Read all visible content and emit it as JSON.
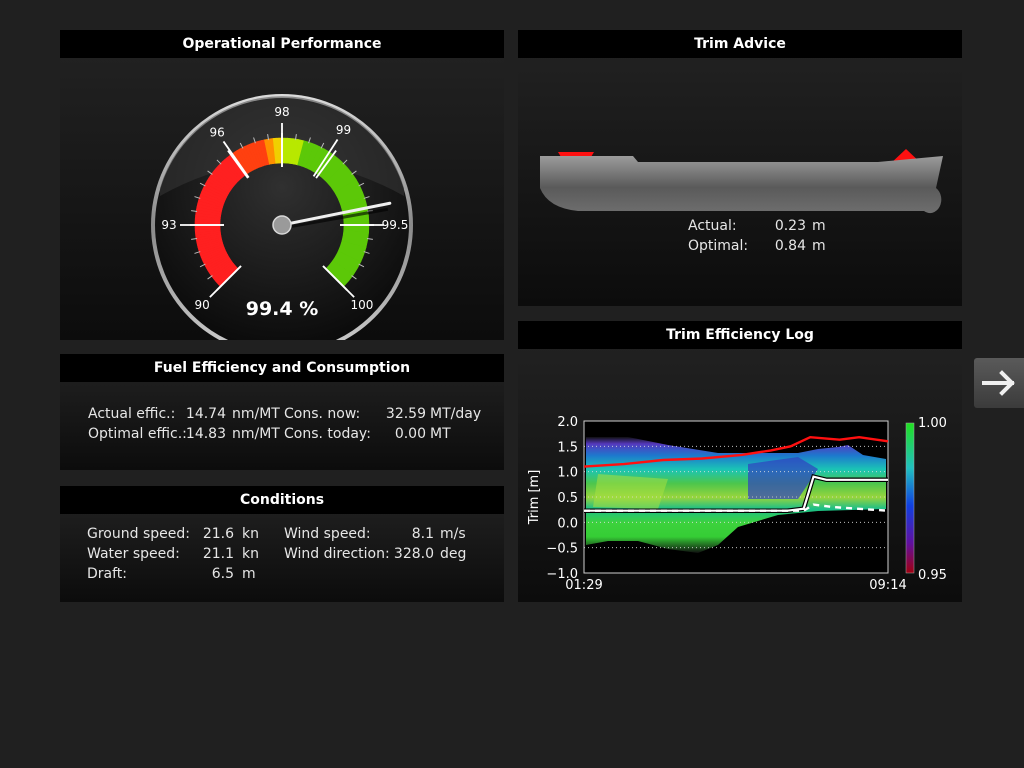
{
  "operational": {
    "title": "Operational Performance",
    "value": 99.4,
    "readout": "99.4 %",
    "ticks": [
      "90",
      "93",
      "96",
      "98",
      "99",
      "99.5",
      "100"
    ]
  },
  "trim_advice": {
    "title": "Trim Advice",
    "actual_label": "Actual:",
    "actual_value": "0.23",
    "optimal_label": "Optimal:",
    "optimal_value": "0.84",
    "unit": "m"
  },
  "fuel": {
    "title": "Fuel Efficiency and Consumption",
    "actual_label": "Actual effic.:",
    "actual_value": "14.74",
    "actual_unit": "nm/MT",
    "optimal_label": "Optimal effic.:",
    "optimal_value": "14.83",
    "optimal_unit": "nm/MT",
    "cons_now_label": "Cons. now:",
    "cons_now_value": "32.59",
    "cons_now_unit": "MT/day",
    "cons_today_label": "Cons. today:",
    "cons_today_value": "0.00",
    "cons_today_unit": "MT"
  },
  "conditions": {
    "title": "Conditions",
    "ground_label": "Ground speed:",
    "ground_value": "21.6",
    "ground_unit": "kn",
    "water_label": "Water speed:",
    "water_value": "21.1",
    "water_unit": "kn",
    "draft_label": "Draft:",
    "draft_value": "6.5",
    "draft_unit": "m",
    "wind_speed_label": "Wind speed:",
    "wind_speed_value": "8.1",
    "wind_speed_unit": "m/s",
    "wind_dir_label": "Wind direction:",
    "wind_dir_value": "328.0",
    "wind_dir_unit": "deg"
  },
  "trim_log": {
    "title": "Trim Efficiency Log",
    "ylabel": "Trim [m]",
    "yticks": [
      "2.0",
      "1.5",
      "1.0",
      "0.5",
      "0.0",
      "−0.5",
      "−1.0"
    ],
    "xticks": [
      "01:29",
      "09:14"
    ],
    "colorbar_max": "1.00",
    "colorbar_min": "0.95"
  },
  "chart_data": {
    "type": "heatmap",
    "title": "Trim Efficiency Log",
    "xlabel": "",
    "ylabel": "Trim [m]",
    "ylim": [
      -1.0,
      2.0
    ],
    "x_range": [
      "01:29",
      "09:14"
    ],
    "colorbar_range": [
      0.95,
      1.0
    ],
    "series": [
      {
        "values": [
          {
            "x": "01:29",
            "y": 1.1
          },
          {
            "x": "02:30",
            "y": 1.15
          },
          {
            "x": "03:30",
            "y": 1.23
          },
          {
            "x": "04:30",
            "y": 1.26
          },
          {
            "x": "05:30",
            "y": 1.33
          },
          {
            "x": "06:15",
            "y": 1.42
          },
          {
            "x": "06:45",
            "y": 1.5
          },
          {
            "x": "07:15",
            "y": 1.68
          },
          {
            "x": "08:00",
            "y": 1.63
          },
          {
            "x": "08:30",
            "y": 1.68
          },
          {
            "x": "09:14",
            "y": 1.6
          }
        ]
      },
      {
        "values": [
          {
            "x": "01:29",
            "y": 0.23
          },
          {
            "x": "06:40",
            "y": 0.23
          },
          {
            "x": "07:05",
            "y": 0.27
          },
          {
            "x": "07:20",
            "y": 0.9
          },
          {
            "x": "07:40",
            "y": 0.84
          },
          {
            "x": "09:14",
            "y": 0.84
          }
        ]
      },
      {
        "values": [
          {
            "x": "01:29",
            "y": 0.23
          },
          {
            "x": "07:05",
            "y": 0.23
          },
          {
            "x": "07:20",
            "y": 0.35
          },
          {
            "x": "07:50",
            "y": 0.3
          },
          {
            "x": "09:14",
            "y": 0.23
          }
        ]
      }
    ]
  },
  "nav": {
    "next_icon": "arrow-right-icon"
  }
}
